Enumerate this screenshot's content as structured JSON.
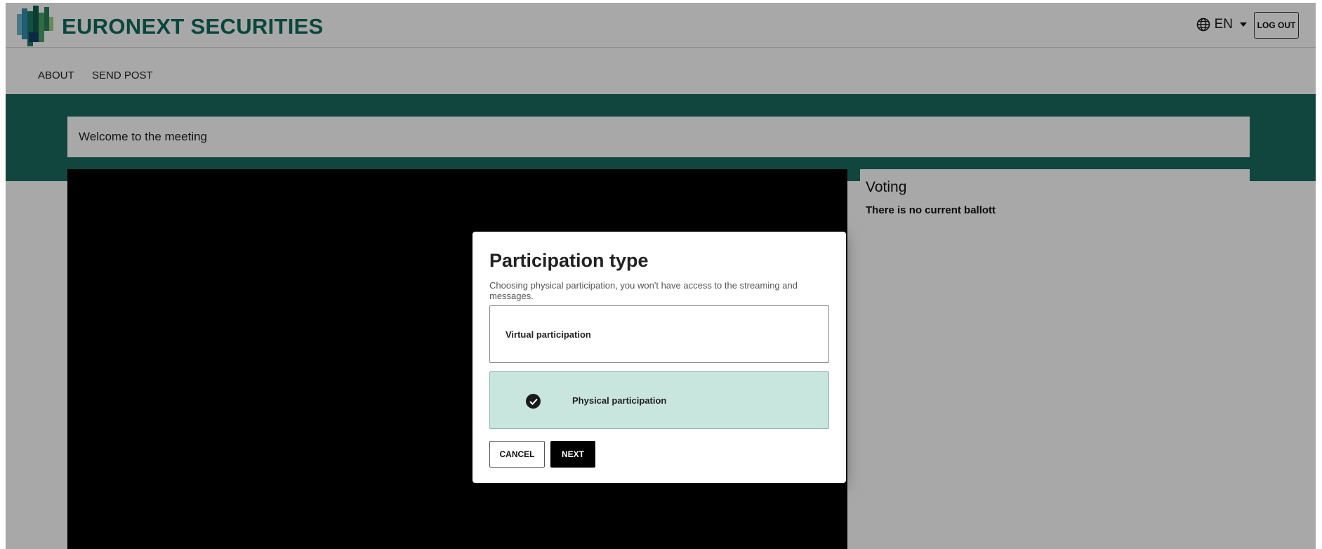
{
  "brand": {
    "name": "EURONEXT SECURITIES"
  },
  "header": {
    "language": "EN",
    "logout_label": "LOG OUT"
  },
  "nav": {
    "items": [
      {
        "label": "ABOUT"
      },
      {
        "label": "SEND POST"
      }
    ]
  },
  "main": {
    "welcome": "Welcome to the meeting",
    "voting": {
      "title": "Voting",
      "status": "There is no current ballott"
    }
  },
  "modal": {
    "title": "Participation type",
    "description": "Choosing physical participation, you won't have access to the streaming and messages.",
    "options": [
      {
        "label": "Virtual participation",
        "selected": false
      },
      {
        "label": "Physical participation",
        "selected": true
      }
    ],
    "cancel_label": "CANCEL",
    "next_label": "NEXT"
  },
  "colors": {
    "brand_green": "#0f6b5c",
    "band_green": "#1a6b5e",
    "selected_option": "#c8e6de"
  },
  "icons": {
    "language": "globe-icon",
    "dropdown": "chevron-down-icon",
    "selected": "check-circle-icon"
  }
}
